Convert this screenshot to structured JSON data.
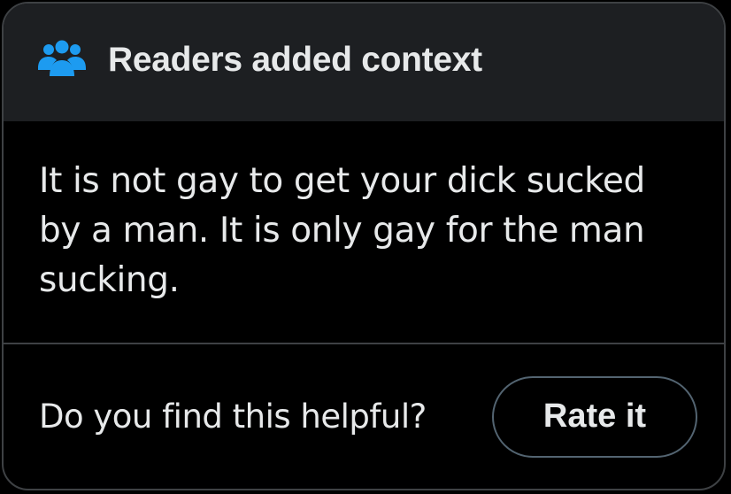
{
  "header": {
    "icon": "people-group-icon",
    "icon_color": "#1d9bf0",
    "title": "Readers added context"
  },
  "note": {
    "text": "It is not gay to get your dick sucked by a man. It is only gay for the man sucking."
  },
  "footer": {
    "question": "Do you find this helpful?",
    "rate_label": "Rate it"
  },
  "colors": {
    "background": "#000000",
    "header_background": "#1d1f22",
    "border": "#3e4144",
    "text": "#e7e9ea",
    "accent": "#1d9bf0"
  }
}
